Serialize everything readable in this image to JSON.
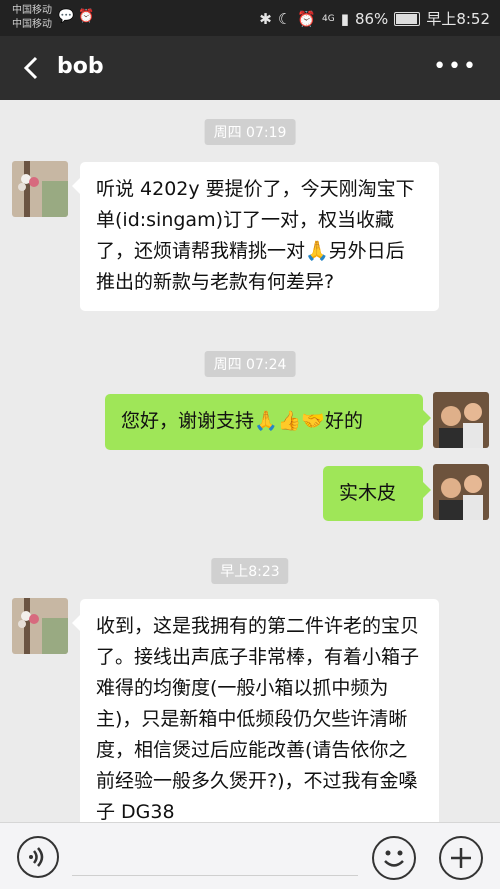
{
  "status_bar": {
    "carrier1": "中国移动",
    "carrier2": "中国移动",
    "network": "4G",
    "battery": "86%",
    "battery_level": 0.86,
    "time": "早上8:52"
  },
  "header": {
    "title": "bob",
    "more_icon": "more-dots-icon",
    "back_icon": "back-chevron-icon"
  },
  "messages": [
    {
      "type": "time",
      "text": "周四 07:19"
    },
    {
      "type": "in",
      "sender": "bob",
      "text": "听说 4202y 要提价了，今天刚淘宝下单(id:singam)订了一对，权当收藏了，还烦请帮我精挑一对🙏另外日后推出的新款与老款有何差异?"
    },
    {
      "type": "time",
      "text": "周四 07:24"
    },
    {
      "type": "out",
      "text": "您好，谢谢支持🙏👍🤝好的"
    },
    {
      "type": "out",
      "text": "实木皮"
    },
    {
      "type": "time",
      "text": "早上8:23"
    },
    {
      "type": "in",
      "sender": "bob",
      "text": "收到，这是我拥有的第二件许老的宝贝了。接线出声底子非常棒，有着小箱子难得的均衡度(一般小箱以抓中频为主)，只是新箱中低频段仍欠些许清晰度，相信煲过后应能改善(请告依你之前经验一般多久煲开?)，不过我有金嗓子 DG38"
    }
  ],
  "input_bar": {
    "voice_icon": "voice-icon",
    "emoji_icon": "emoji-icon",
    "plus_icon": "plus-icon"
  }
}
